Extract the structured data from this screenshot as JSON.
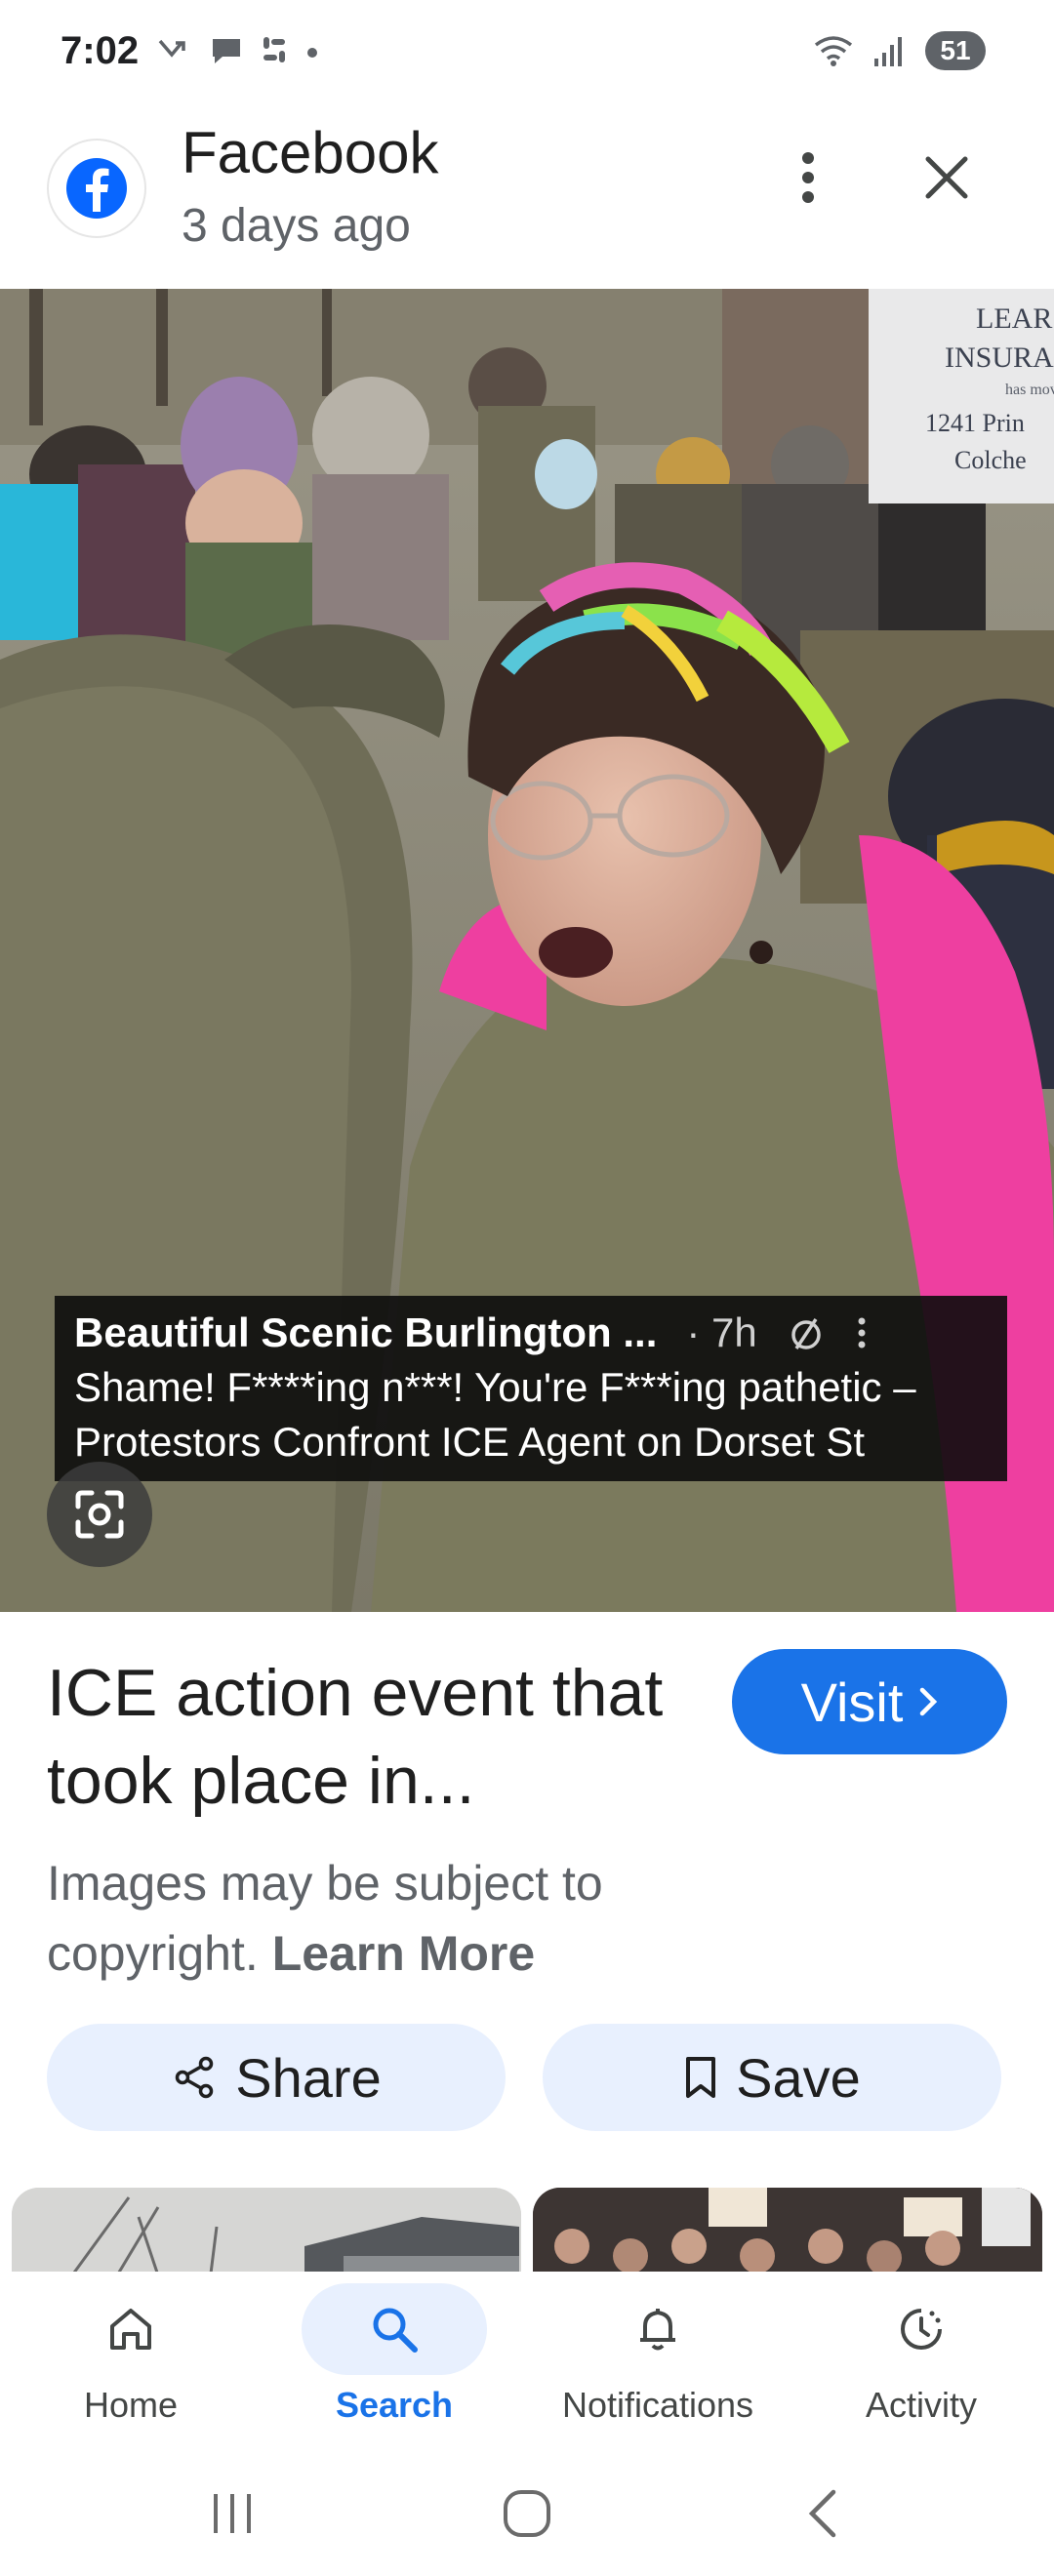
{
  "status_bar": {
    "time": "7:02",
    "battery": "51"
  },
  "header": {
    "source_name": "Facebook",
    "posted": "3 days ago"
  },
  "image_caption": {
    "line1_source": "Beautiful Scenic Burlington ...",
    "line1_meta": "· 7h",
    "line2": "Shame! F****ing n***! You're F***ing pathetic –",
    "line3": "Protestors Confront ICE Agent on Dorset St"
  },
  "sign_text": {
    "l1": "LEAR",
    "l2": "INSURA",
    "l3": "has mov",
    "l4": "1241 Prin",
    "l5": "Colche"
  },
  "result": {
    "title": "ICE action event that took place in...",
    "visit_label": "Visit",
    "copyright_text": "Images may be subject to copyright.",
    "learn_more": "Learn More"
  },
  "actions": {
    "share_label": "Share",
    "save_label": "Save"
  },
  "bottom_nav": {
    "items": [
      {
        "label": "Home",
        "icon": "home-icon",
        "active": false
      },
      {
        "label": "Search",
        "icon": "search-icon",
        "active": true
      },
      {
        "label": "Notifications",
        "icon": "bell-icon",
        "active": false
      },
      {
        "label": "Activity",
        "icon": "activity-icon",
        "active": false
      }
    ]
  },
  "colors": {
    "accent": "#1a73e8",
    "chip_bg": "#e8f0fe",
    "facebook_blue": "#0866ff"
  }
}
